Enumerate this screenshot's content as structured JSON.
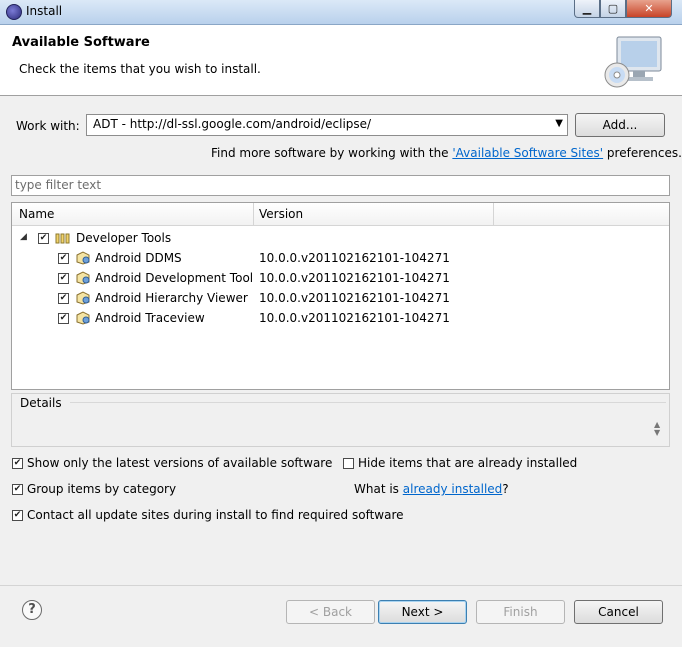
{
  "window": {
    "title": "Install"
  },
  "header": {
    "title": "Available Software",
    "subtitle": "Check the items that you wish to install."
  },
  "work_with": {
    "label": "Work with:",
    "value": "ADT - http://dl-ssl.google.com/android/eclipse/",
    "add_button": "Add...",
    "find_more_prefix": "Find more software by working with the ",
    "find_more_link": "'Available Software Sites'",
    "find_more_suffix": " preferences."
  },
  "filter": {
    "placeholder": "type filter text"
  },
  "tree": {
    "columns": [
      "Name",
      "Version"
    ],
    "group": {
      "name": "Developer Tools",
      "checked": true
    },
    "items": [
      {
        "name": "Android DDMS",
        "version": "10.0.0.v201102162101-104271"
      },
      {
        "name": "Android Development Tool",
        "version": "10.0.0.v201102162101-104271"
      },
      {
        "name": "Android Hierarchy Viewer",
        "version": "10.0.0.v201102162101-104271"
      },
      {
        "name": "Android Traceview",
        "version": "10.0.0.v201102162101-104271"
      }
    ]
  },
  "details": {
    "label": "Details"
  },
  "options": {
    "show_latest": "Show only the latest versions of available software",
    "hide_installed": "Hide items that are already installed",
    "group_by_category": "Group items by category",
    "what_is_prefix": "What is ",
    "what_is_link": "already installed",
    "what_is_suffix": "?",
    "contact_sites": "Contact all update sites during install to find required software"
  },
  "buttons": {
    "back": "< Back",
    "next": "Next >",
    "finish": "Finish",
    "cancel": "Cancel",
    "help": "?"
  },
  "colors": {
    "link": "#0066cc",
    "titlebar": "#b9d1ec"
  }
}
